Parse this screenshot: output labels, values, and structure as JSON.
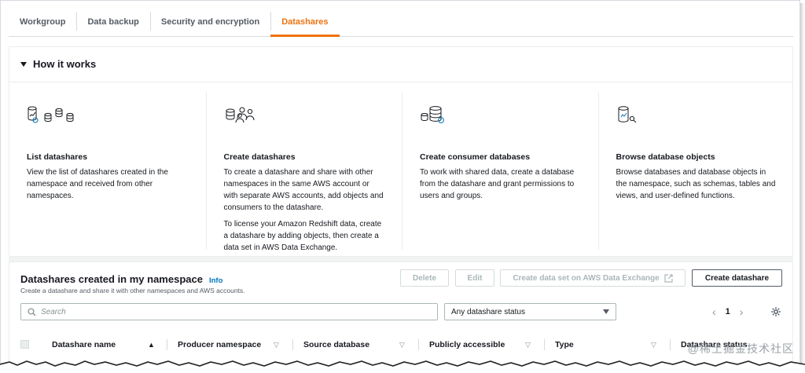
{
  "tabs": [
    {
      "label": "Workgroup",
      "active": false
    },
    {
      "label": "Data backup",
      "active": false
    },
    {
      "label": "Security and encryption",
      "active": false
    },
    {
      "label": "Datashares",
      "active": true
    }
  ],
  "accent_color": "#ec7211",
  "link_color": "#0073bb",
  "how_it_works": {
    "title": "How it works",
    "columns": [
      {
        "icon": "database-chart-icon",
        "title": "List datashares",
        "paragraphs": [
          "View the list of datashares created in the namespace and received from other namespaces."
        ]
      },
      {
        "icon": "database-users-icon",
        "title": "Create datashares",
        "paragraphs": [
          "To create a datashare and share with other namespaces in the same AWS account or with separate AWS accounts, add objects and consumers to the datashare.",
          "To license your Amazon Redshift data, create a datashare by adding objects, then create a data set in AWS Data Exchange."
        ]
      },
      {
        "icon": "consumer-database-icon",
        "title": "Create consumer databases",
        "paragraphs": [
          "To work with shared data, create a database from the datashare and grant permissions to users and groups."
        ]
      },
      {
        "icon": "database-search-icon",
        "title": "Browse database objects",
        "paragraphs": [
          "Browse databases and database objects in the namespace, such as schemas, tables and views, and user-defined functions."
        ]
      }
    ]
  },
  "datashares_panel": {
    "title": "Datashares created in my namespace",
    "info_label": "Info",
    "description": "Create a datashare and share it with other namespaces and AWS accounts.",
    "buttons": {
      "delete": "Delete",
      "edit": "Edit",
      "create_data_set": "Create data set on AWS Data Exchange",
      "create_datashare": "Create datashare"
    },
    "search_placeholder": "Search",
    "status_filter": "Any datashare status",
    "page": "1",
    "columns": [
      "Datashare name",
      "Producer namespace",
      "Source database",
      "Publicly accessible",
      "Type",
      "Datashare status"
    ]
  },
  "watermark": "@稀土掘金技术社区"
}
